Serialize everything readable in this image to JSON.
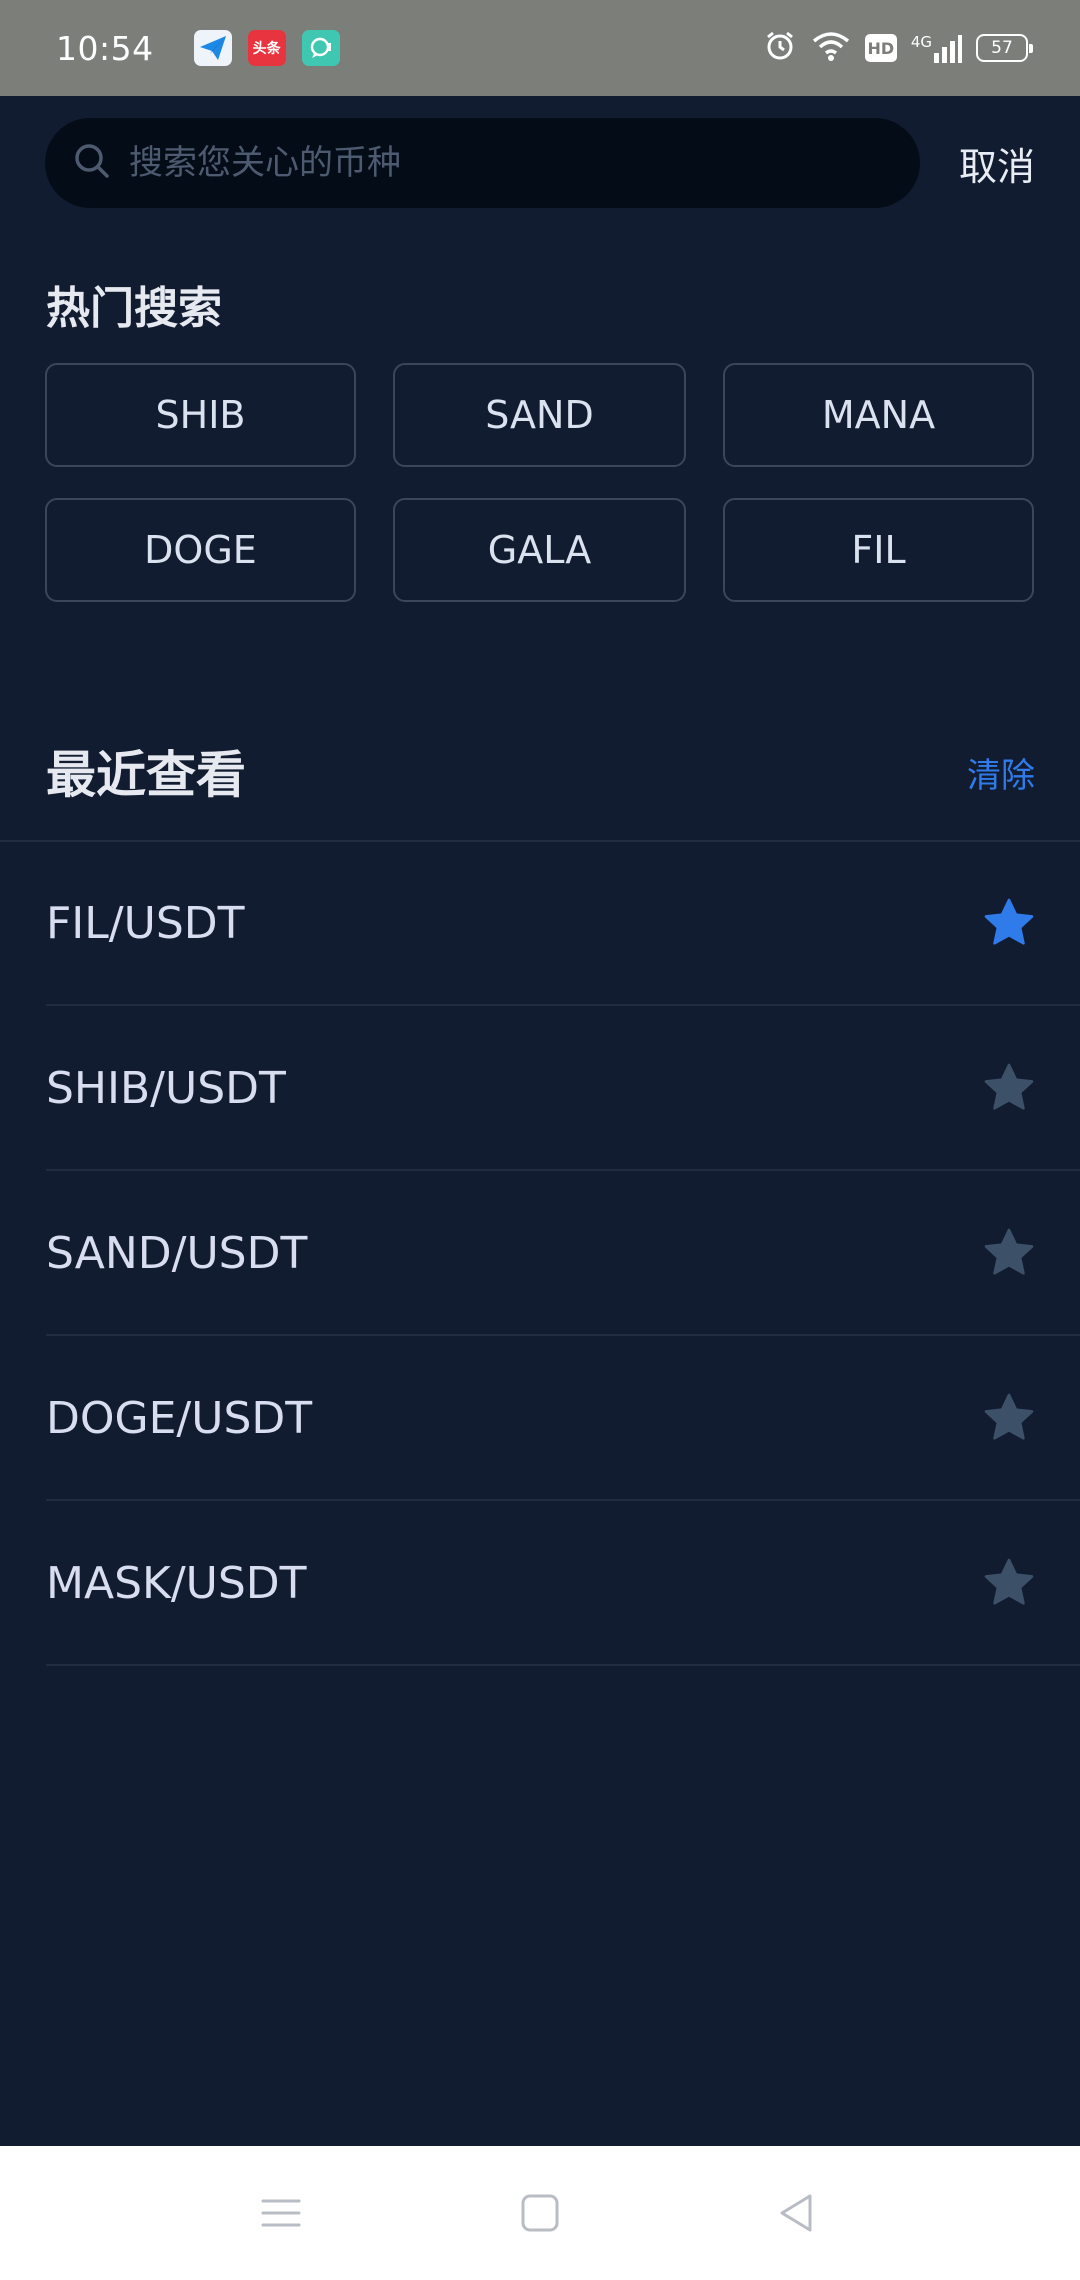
{
  "status_bar": {
    "time": "10:54",
    "app_badge_toutiao": "头条",
    "network": "4G",
    "hd": "HD",
    "battery": "57"
  },
  "search": {
    "placeholder": "搜索您关心的币种",
    "value": "",
    "cancel_label": "取消"
  },
  "hot_search": {
    "title": "热门搜索",
    "chips": [
      "SHIB",
      "SAND",
      "MANA",
      "DOGE",
      "GALA",
      "FIL"
    ]
  },
  "recent": {
    "title": "最近查看",
    "clear_label": "清除",
    "items": [
      {
        "pair": "FIL/USDT",
        "favorited": true
      },
      {
        "pair": "SHIB/USDT",
        "favorited": false
      },
      {
        "pair": "SAND/USDT",
        "favorited": false
      },
      {
        "pair": "DOGE/USDT",
        "favorited": false
      },
      {
        "pair": "MASK/USDT",
        "favorited": false
      }
    ]
  },
  "colors": {
    "background": "#121c31",
    "accent": "#2f7bea",
    "star_active": "#2f7bea",
    "star_inactive": "#3c5068"
  },
  "icons": {
    "search": "search-icon",
    "star": "star-icon",
    "nav_menu": "menu-icon",
    "nav_home": "home-square-icon",
    "nav_back": "back-triangle-icon"
  }
}
